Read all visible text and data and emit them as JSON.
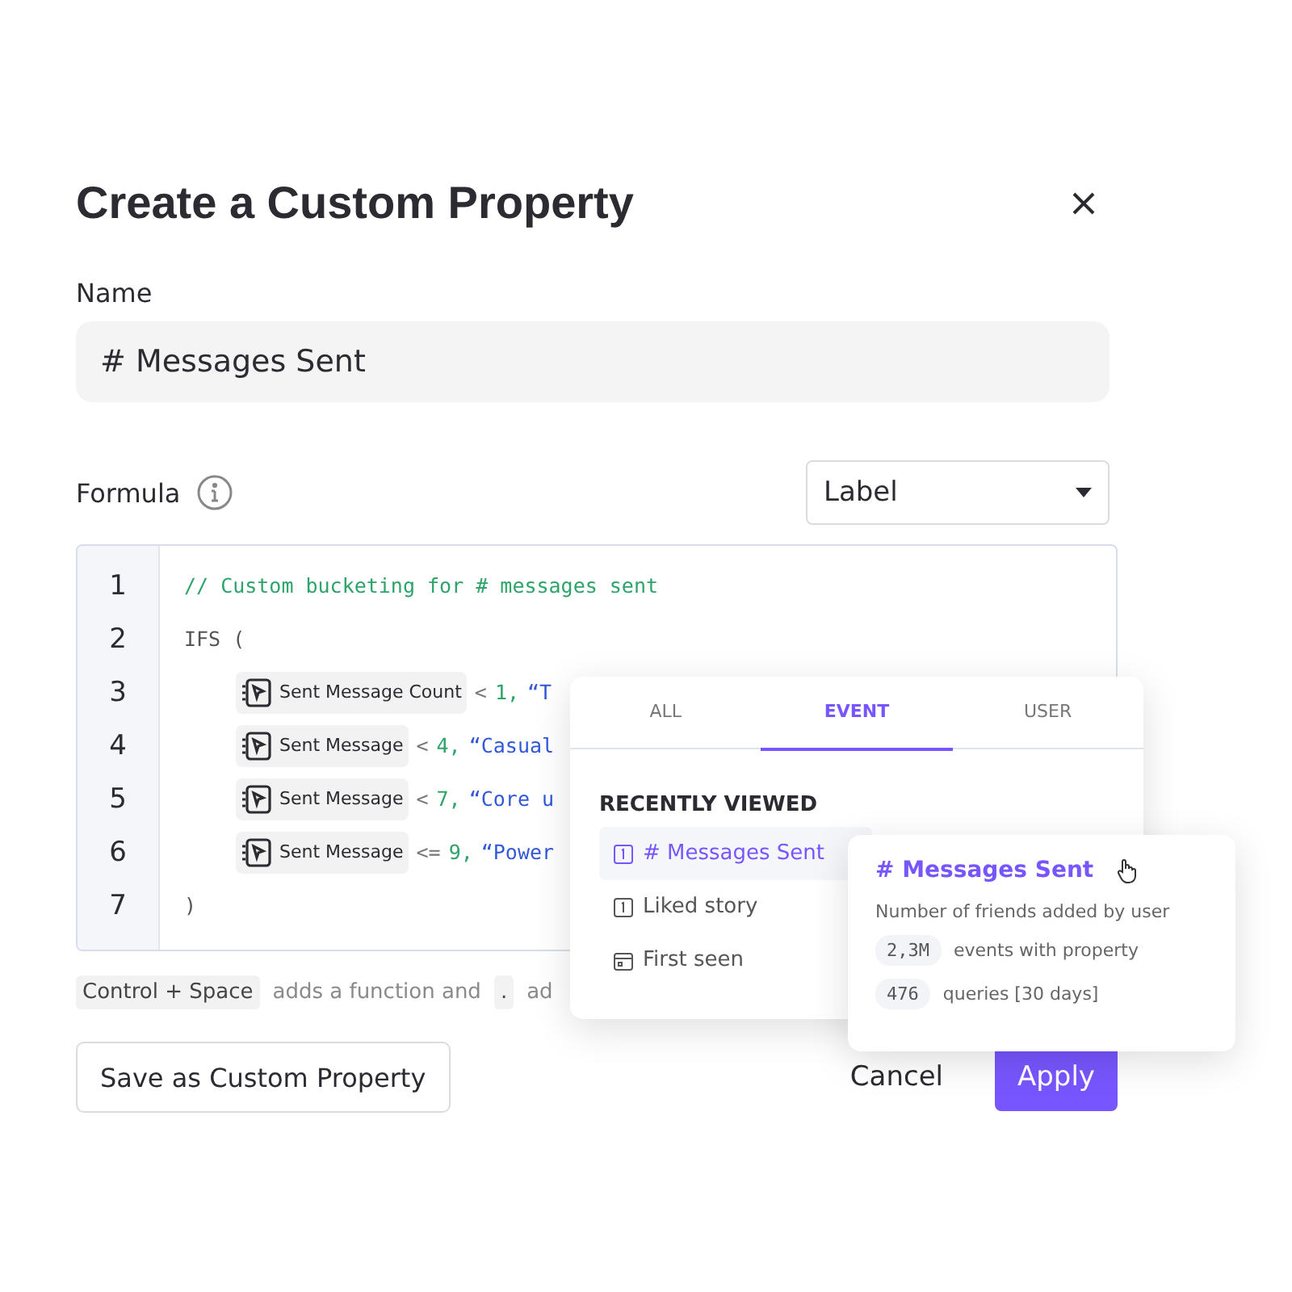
{
  "dialog": {
    "title": "Create a Custom Property",
    "name_label": "Name",
    "name_value": "# Messages Sent",
    "formula_label": "Formula",
    "type_select": "Label"
  },
  "code_lines": [
    {
      "number": "1",
      "kind": "comment",
      "tokens": [
        {
          "kind": "comment",
          "text": "// Custom bucketing for # messages sent"
        }
      ]
    },
    {
      "number": "2",
      "kind": "plain",
      "tokens": [
        {
          "kind": "plain",
          "text": "IFS ("
        }
      ]
    },
    {
      "number": "3",
      "kind": "condition",
      "tokens": [
        {
          "kind": "chip",
          "text": "Sent Message Count"
        },
        {
          "kind": "op",
          "text": "<"
        },
        {
          "kind": "num",
          "text": "1,"
        },
        {
          "kind": "str",
          "text": "“T"
        }
      ]
    },
    {
      "number": "4",
      "kind": "condition",
      "tokens": [
        {
          "kind": "chip",
          "text": "Sent Message"
        },
        {
          "kind": "op",
          "text": "<"
        },
        {
          "kind": "num",
          "text": "4,"
        },
        {
          "kind": "str",
          "text": "“Casual"
        }
      ]
    },
    {
      "number": "5",
      "kind": "condition",
      "tokens": [
        {
          "kind": "chip",
          "text": "Sent Message"
        },
        {
          "kind": "op",
          "text": "<"
        },
        {
          "kind": "num",
          "text": "7,"
        },
        {
          "kind": "str",
          "text": "“Core u"
        }
      ]
    },
    {
      "number": "6",
      "kind": "condition",
      "tokens": [
        {
          "kind": "chip",
          "text": "Sent Message"
        },
        {
          "kind": "op",
          "text": "<="
        },
        {
          "kind": "num",
          "text": "9,"
        },
        {
          "kind": "str",
          "text": "“Power"
        }
      ]
    },
    {
      "number": "7",
      "kind": "plain",
      "tokens": [
        {
          "kind": "plain",
          "text": ")"
        }
      ]
    }
  ],
  "hint": [
    {
      "kind": "key",
      "text": "Control + Space"
    },
    {
      "kind": "text",
      "text": "adds a function and"
    },
    {
      "kind": "key",
      "text": "."
    },
    {
      "kind": "text",
      "text": "ad"
    }
  ],
  "popup": {
    "tabs": [
      {
        "label": "ALL",
        "selected": false
      },
      {
        "label": "EVENT",
        "selected": true
      },
      {
        "label": "USER",
        "selected": false
      }
    ],
    "section": "RECENTLY VIEWED",
    "items": [
      {
        "label": "# Messages Sent",
        "kind": "number",
        "selected": true
      },
      {
        "label": "Liked story",
        "kind": "number",
        "selected": false
      },
      {
        "label": "First seen",
        "kind": "date",
        "selected": false
      }
    ]
  },
  "tooltip": {
    "title": "# Messages Sent",
    "description": "Number of friends added by user",
    "stats": [
      {
        "value": "2,3M",
        "label": "events with property"
      },
      {
        "value": "476",
        "label": "queries [30 days]"
      }
    ]
  },
  "buttons": {
    "save": "Save as Custom Property",
    "cancel": "Cancel",
    "apply": "Apply"
  }
}
